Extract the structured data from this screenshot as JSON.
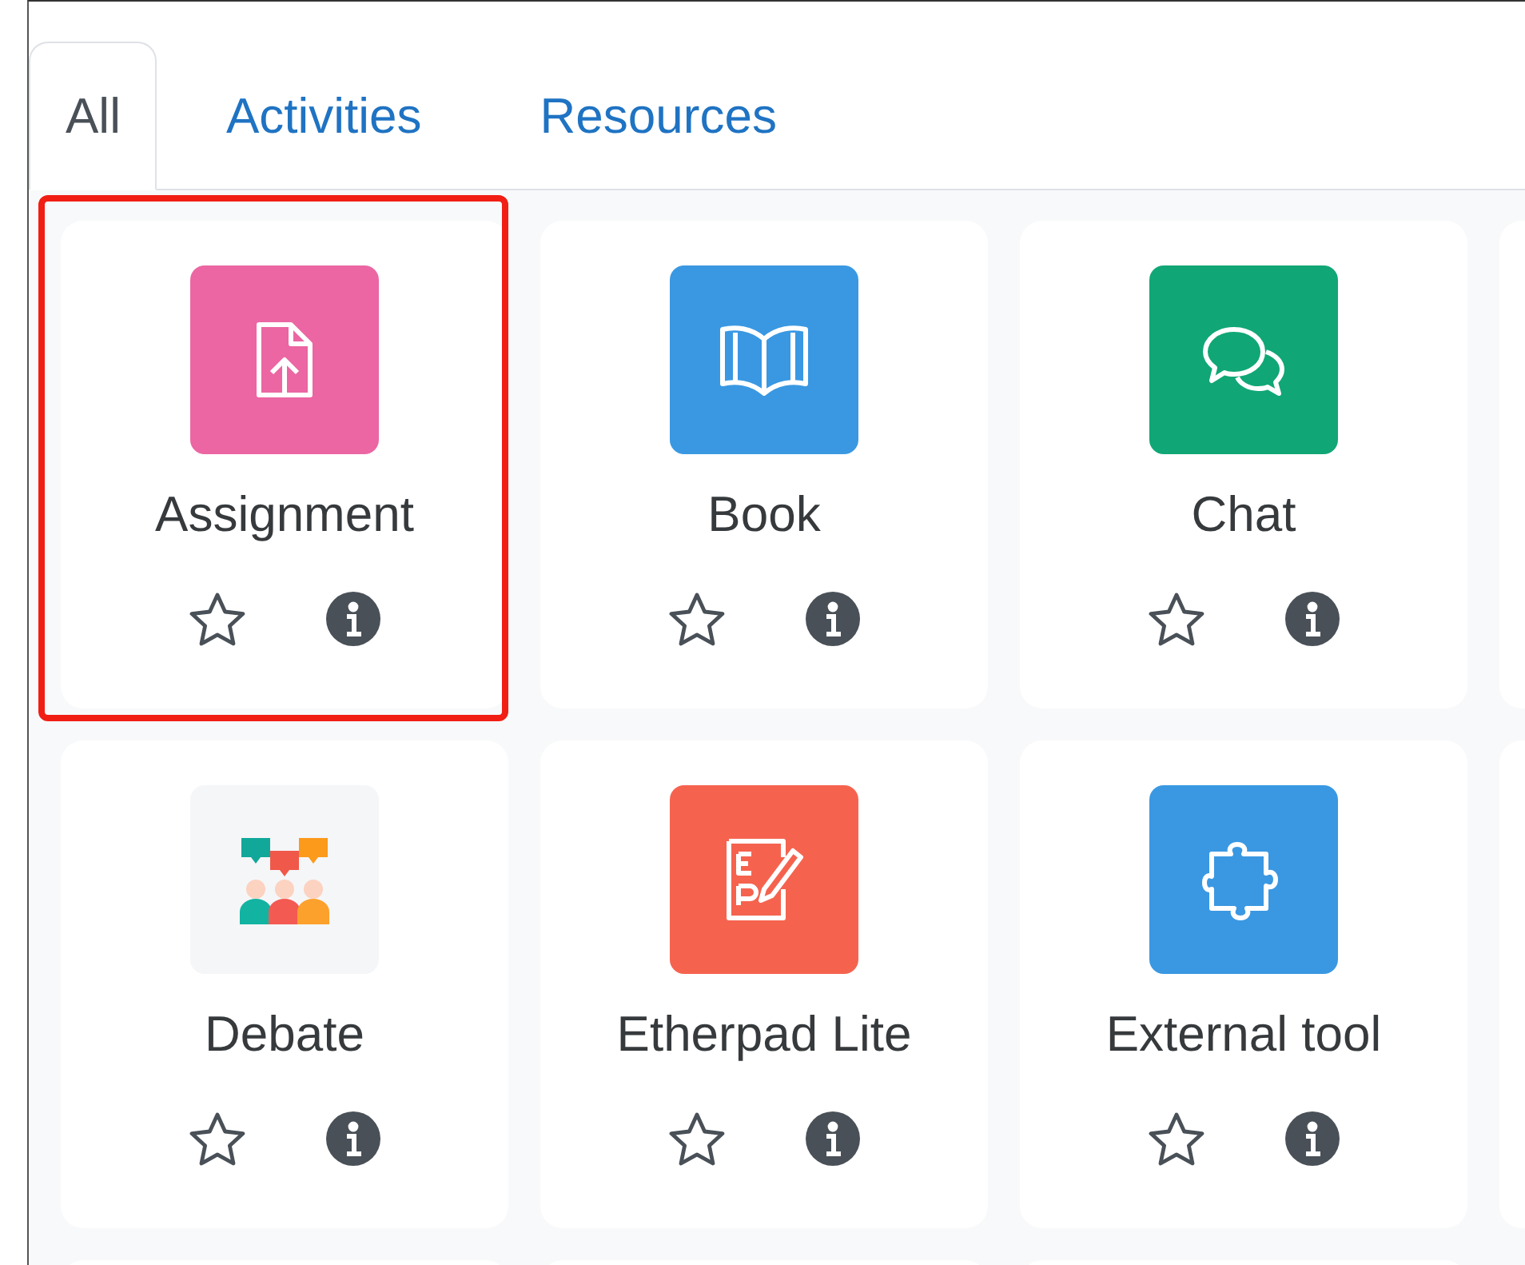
{
  "tabs": [
    {
      "label": "All",
      "selected": true
    },
    {
      "label": "Activities",
      "selected": false
    },
    {
      "label": "Resources",
      "selected": false
    }
  ],
  "modules": [
    {
      "name": "Assignment",
      "kind": "assignment",
      "highlighted": true,
      "starred": false
    },
    {
      "name": "Book",
      "kind": "book",
      "highlighted": false,
      "starred": false
    },
    {
      "name": "Chat",
      "kind": "chat",
      "highlighted": false,
      "starred": false
    },
    {
      "name": "Debate",
      "kind": "debate",
      "highlighted": false,
      "starred": false
    },
    {
      "name": "Etherpad Lite",
      "kind": "etherpad",
      "highlighted": false,
      "starred": false
    },
    {
      "name": "External tool",
      "kind": "external",
      "highlighted": false,
      "starred": false
    }
  ]
}
